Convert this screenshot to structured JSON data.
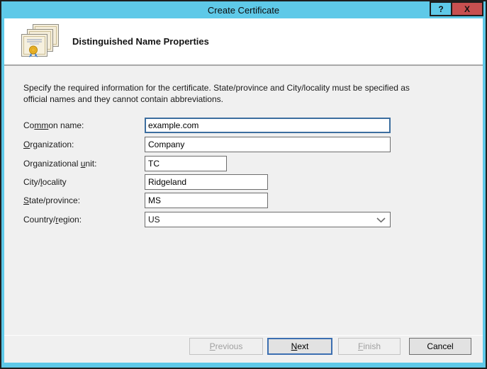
{
  "window": {
    "title": "Create Certificate"
  },
  "titlebar": {
    "help_glyph": "?",
    "close_glyph": "X"
  },
  "header": {
    "title": "Distinguished Name Properties"
  },
  "description": {
    "line1": "Specify the required information for the certificate. State/province and City/locality must be specified as",
    "line2": "official names and they cannot contain abbreviations."
  },
  "form": {
    "fields": [
      {
        "id": "common-name",
        "label": {
          "pre": "Co",
          "key": "mm",
          "post": "on name:"
        },
        "value": "example.com",
        "state": "focused",
        "width": "full"
      },
      {
        "id": "organization",
        "label": {
          "pre": "",
          "key": "O",
          "post": "rganization:"
        },
        "value": "Company",
        "state": "normal",
        "width": "full"
      },
      {
        "id": "organizational-unit",
        "label": {
          "pre": "Organizational ",
          "key": "u",
          "post": "nit:"
        },
        "value": "TC",
        "state": "normal",
        "width": "small"
      },
      {
        "id": "city-locality",
        "label": {
          "pre": "City/",
          "key": "l",
          "post": "ocality"
        },
        "value": "Ridgeland",
        "state": "normal",
        "width": "medium"
      },
      {
        "id": "state-province",
        "label": {
          "pre": "",
          "key": "S",
          "post": "tate/province:"
        },
        "value": "MS",
        "state": "normal",
        "width": "medium"
      },
      {
        "id": "country-region",
        "label": {
          "pre": "Country/",
          "key": "r",
          "post": "egion:"
        },
        "value": "US",
        "state": "normal",
        "width": "full",
        "type": "dropdown"
      }
    ]
  },
  "buttons": {
    "previous": {
      "pre": "",
      "key": "P",
      "post": "revious",
      "enabled": false
    },
    "next": {
      "pre": "",
      "key": "N",
      "post": "ext",
      "enabled": true,
      "default": true
    },
    "finish": {
      "pre": "",
      "key": "F",
      "post": "inish",
      "enabled": false
    },
    "cancel": {
      "pre": "Cancel",
      "key": "",
      "post": "",
      "enabled": true
    }
  },
  "icons": {
    "certificates": "stacked-certificates-with-gold-seal",
    "chevron_down": "thin-v-chevron",
    "help": "?",
    "close": "X"
  },
  "colors": {
    "titlebar_blue": "#5ec9e8",
    "close_button_red": "#c75050",
    "content_background": "#f0f0f0",
    "header_background": "#ffffff",
    "focus_border_blue": "#3c6e9f",
    "default_button_border_blue": "#3c6fb1",
    "seal_gold": "#edb72c",
    "ribbon_blue": "#3f7fd4"
  }
}
